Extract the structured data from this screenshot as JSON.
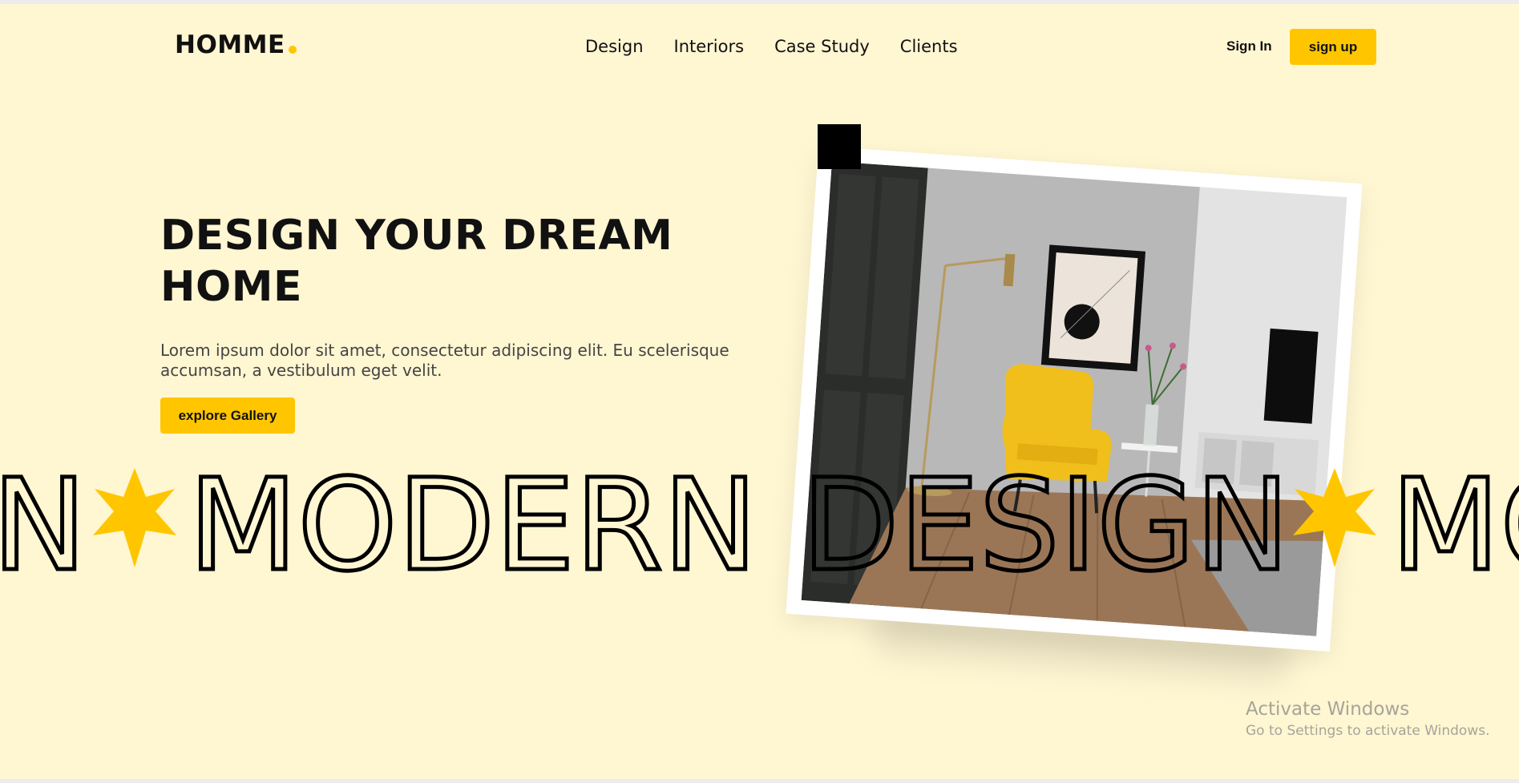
{
  "header": {
    "logo": "HOMME",
    "nav": [
      "Design",
      "Interiors",
      "Case Study",
      "Clients"
    ],
    "sign_in": "Sign In",
    "sign_up": "sign up"
  },
  "hero": {
    "title_line1": "DESIGN YOUR DREAM",
    "title_line2": "HOME",
    "description_line1": "Lorem ipsum dolor sit amet, consectetur adipiscing elit. Eu scelerisque",
    "description_line2": "accumsan, a vestibulum eget velit.",
    "cta": "explore Gallery"
  },
  "marquee": {
    "text_a": "N",
    "text_b": "MODERN",
    "text_c": "DESIGN",
    "text_d": "MO"
  },
  "watermark": {
    "title": "Activate Windows",
    "subtitle": "Go to Settings to activate Windows."
  },
  "colors": {
    "background": "#fff6d2",
    "accent": "#ffc600",
    "text": "#111111"
  },
  "icons": {
    "star": "star-icon",
    "logo_dot": "logo-dot-icon"
  }
}
